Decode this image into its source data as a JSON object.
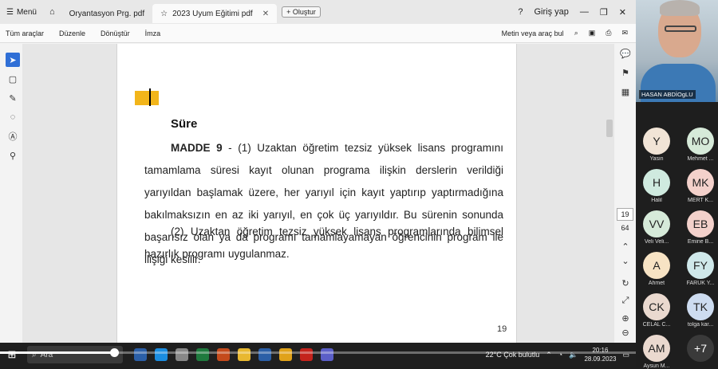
{
  "tabbar": {
    "menu_label": "Menü",
    "tabs": [
      {
        "label": "Oryantasyon Prg. pdf",
        "active": false
      },
      {
        "label": "2023 Uyum Eğitimi pdf",
        "active": true
      }
    ],
    "new_tab_label": "Oluştur",
    "signin_label": "Giriş yap"
  },
  "toolbar": {
    "menu": [
      "Tüm araçlar",
      "Düzenle",
      "Dönüştür",
      "İmza"
    ],
    "search_placeholder": "Metin veya araç bul"
  },
  "document": {
    "heading": "Süre",
    "article_label": "MADDE 9",
    "paragraph1_rest": " - (1) Uzaktan öğretim tezsiz yüksek lisans programını tamamlama süresi kayıt olunan programa ilişkin derslerin verildiği yarıyıldan başlamak üzere, her yarıyıl için kayıt yaptırıp yaptırmadığına bakılmaksızın en az iki yarıyıl, en çok üç yarıyıldır. Bu sürenin sonunda başarısız olan ya da programı tamamlayamayan öğrencinin program ile ilişiği kesilir.",
    "paragraph2": "(2) Uzaktan öğretim tezsiz yüksek lisans programlarında bilimsel hazırlık programı uygulanmaz.",
    "page_footer": "19"
  },
  "navigation": {
    "current_page": "19",
    "total_pages": "64"
  },
  "taskbar": {
    "search_text": "Ara",
    "weather": "22°C  Çok bulutlu",
    "time": "20:16",
    "date": "28.09.2023"
  },
  "video_progress": 0.18,
  "presenter": {
    "name": "HASAN ABDİOgLU"
  },
  "participants": [
    {
      "initials": "Y",
      "name": "Yasin",
      "color": "#f1e4d6"
    },
    {
      "initials": "MO",
      "name": "Mehmet ...",
      "color": "#d6ead9"
    },
    {
      "initials": "H",
      "name": "Halil",
      "color": "#cfeadf"
    },
    {
      "initials": "MK",
      "name": "MERT K...",
      "color": "#f3d1cb"
    },
    {
      "initials": "VV",
      "name": "Veli Veli...",
      "color": "#d6ead9"
    },
    {
      "initials": "EB",
      "name": "Emine B...",
      "color": "#f3d1cb"
    },
    {
      "initials": "A",
      "name": "Ahmet",
      "color": "#f7e3c4"
    },
    {
      "initials": "FY",
      "name": "FARUK Y...",
      "color": "#cfe8ea"
    },
    {
      "initials": "CK",
      "name": "CELAL C...",
      "color": "#ead9cf"
    },
    {
      "initials": "TK",
      "name": "tolga kar...",
      "color": "#cddcf0"
    },
    {
      "initials": "AM",
      "name": "Aysun M...",
      "color": "#ead9cf"
    },
    {
      "initials": "+7",
      "name": "",
      "color": "#3a3a3a"
    }
  ]
}
